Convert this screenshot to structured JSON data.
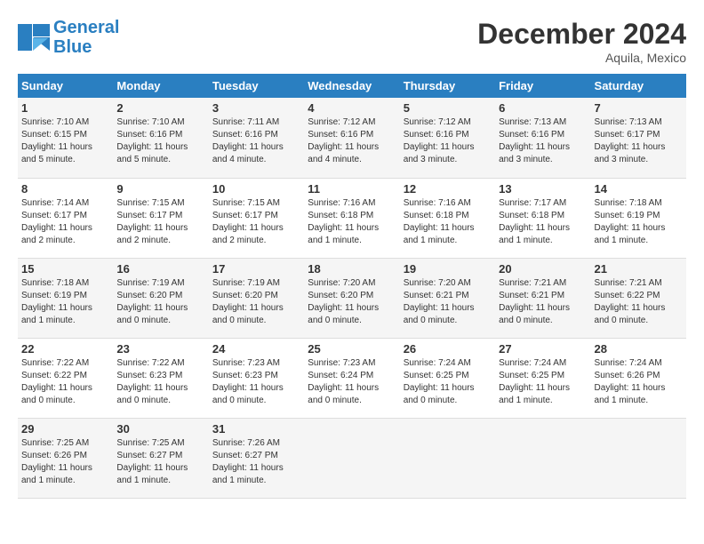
{
  "header": {
    "logo_line1": "General",
    "logo_line2": "Blue",
    "month_year": "December 2024",
    "location": "Aquila, Mexico"
  },
  "weekdays": [
    "Sunday",
    "Monday",
    "Tuesday",
    "Wednesday",
    "Thursday",
    "Friday",
    "Saturday"
  ],
  "weeks": [
    [
      {
        "day": "1",
        "sunrise": "7:10 AM",
        "sunset": "6:15 PM",
        "daylight": "11 hours and 5 minutes."
      },
      {
        "day": "2",
        "sunrise": "7:10 AM",
        "sunset": "6:16 PM",
        "daylight": "11 hours and 5 minutes."
      },
      {
        "day": "3",
        "sunrise": "7:11 AM",
        "sunset": "6:16 PM",
        "daylight": "11 hours and 4 minutes."
      },
      {
        "day": "4",
        "sunrise": "7:12 AM",
        "sunset": "6:16 PM",
        "daylight": "11 hours and 4 minutes."
      },
      {
        "day": "5",
        "sunrise": "7:12 AM",
        "sunset": "6:16 PM",
        "daylight": "11 hours and 3 minutes."
      },
      {
        "day": "6",
        "sunrise": "7:13 AM",
        "sunset": "6:16 PM",
        "daylight": "11 hours and 3 minutes."
      },
      {
        "day": "7",
        "sunrise": "7:13 AM",
        "sunset": "6:17 PM",
        "daylight": "11 hours and 3 minutes."
      }
    ],
    [
      {
        "day": "8",
        "sunrise": "7:14 AM",
        "sunset": "6:17 PM",
        "daylight": "11 hours and 2 minutes."
      },
      {
        "day": "9",
        "sunrise": "7:15 AM",
        "sunset": "6:17 PM",
        "daylight": "11 hours and 2 minutes."
      },
      {
        "day": "10",
        "sunrise": "7:15 AM",
        "sunset": "6:17 PM",
        "daylight": "11 hours and 2 minutes."
      },
      {
        "day": "11",
        "sunrise": "7:16 AM",
        "sunset": "6:18 PM",
        "daylight": "11 hours and 1 minute."
      },
      {
        "day": "12",
        "sunrise": "7:16 AM",
        "sunset": "6:18 PM",
        "daylight": "11 hours and 1 minute."
      },
      {
        "day": "13",
        "sunrise": "7:17 AM",
        "sunset": "6:18 PM",
        "daylight": "11 hours and 1 minute."
      },
      {
        "day": "14",
        "sunrise": "7:18 AM",
        "sunset": "6:19 PM",
        "daylight": "11 hours and 1 minute."
      }
    ],
    [
      {
        "day": "15",
        "sunrise": "7:18 AM",
        "sunset": "6:19 PM",
        "daylight": "11 hours and 1 minute."
      },
      {
        "day": "16",
        "sunrise": "7:19 AM",
        "sunset": "6:20 PM",
        "daylight": "11 hours and 0 minutes."
      },
      {
        "day": "17",
        "sunrise": "7:19 AM",
        "sunset": "6:20 PM",
        "daylight": "11 hours and 0 minutes."
      },
      {
        "day": "18",
        "sunrise": "7:20 AM",
        "sunset": "6:20 PM",
        "daylight": "11 hours and 0 minutes."
      },
      {
        "day": "19",
        "sunrise": "7:20 AM",
        "sunset": "6:21 PM",
        "daylight": "11 hours and 0 minutes."
      },
      {
        "day": "20",
        "sunrise": "7:21 AM",
        "sunset": "6:21 PM",
        "daylight": "11 hours and 0 minutes."
      },
      {
        "day": "21",
        "sunrise": "7:21 AM",
        "sunset": "6:22 PM",
        "daylight": "11 hours and 0 minutes."
      }
    ],
    [
      {
        "day": "22",
        "sunrise": "7:22 AM",
        "sunset": "6:22 PM",
        "daylight": "11 hours and 0 minutes."
      },
      {
        "day": "23",
        "sunrise": "7:22 AM",
        "sunset": "6:23 PM",
        "daylight": "11 hours and 0 minutes."
      },
      {
        "day": "24",
        "sunrise": "7:23 AM",
        "sunset": "6:23 PM",
        "daylight": "11 hours and 0 minutes."
      },
      {
        "day": "25",
        "sunrise": "7:23 AM",
        "sunset": "6:24 PM",
        "daylight": "11 hours and 0 minutes."
      },
      {
        "day": "26",
        "sunrise": "7:24 AM",
        "sunset": "6:25 PM",
        "daylight": "11 hours and 0 minutes."
      },
      {
        "day": "27",
        "sunrise": "7:24 AM",
        "sunset": "6:25 PM",
        "daylight": "11 hours and 1 minute."
      },
      {
        "day": "28",
        "sunrise": "7:24 AM",
        "sunset": "6:26 PM",
        "daylight": "11 hours and 1 minute."
      }
    ],
    [
      {
        "day": "29",
        "sunrise": "7:25 AM",
        "sunset": "6:26 PM",
        "daylight": "11 hours and 1 minute."
      },
      {
        "day": "30",
        "sunrise": "7:25 AM",
        "sunset": "6:27 PM",
        "daylight": "11 hours and 1 minute."
      },
      {
        "day": "31",
        "sunrise": "7:26 AM",
        "sunset": "6:27 PM",
        "daylight": "11 hours and 1 minute."
      },
      null,
      null,
      null,
      null
    ]
  ],
  "labels": {
    "sunrise": "Sunrise:",
    "sunset": "Sunset:",
    "daylight": "Daylight:"
  }
}
